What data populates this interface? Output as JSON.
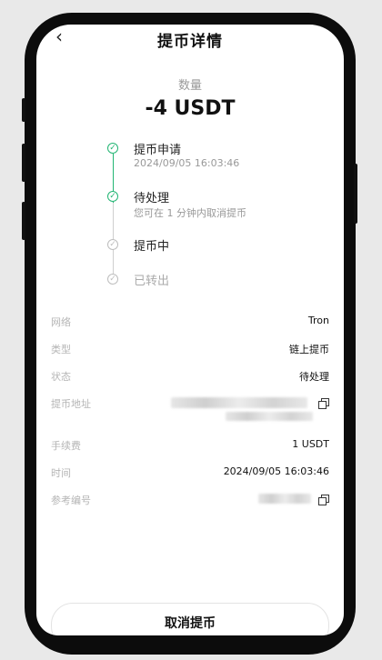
{
  "header": {
    "back_icon": "chevron-left-icon",
    "title": "提币详情"
  },
  "summary": {
    "label": "数量",
    "amount": "-4 USDT"
  },
  "timeline": [
    {
      "title": "提币申请",
      "subtitle": "2024/09/05 16:03:46",
      "status": "done"
    },
    {
      "title": "待处理",
      "subtitle": "您可在 1 分钟内取消提币",
      "status": "done"
    },
    {
      "title": "提币中",
      "subtitle": "",
      "status": "pending"
    },
    {
      "title": "已转出",
      "subtitle": "",
      "status": "pending"
    }
  ],
  "details": {
    "network": {
      "label": "网络",
      "value": "Tron"
    },
    "type": {
      "label": "类型",
      "value": "链上提币"
    },
    "status": {
      "label": "状态",
      "value": "待处理"
    },
    "address": {
      "label": "提币地址"
    },
    "fee": {
      "label": "手续费",
      "value": "1 USDT"
    },
    "time": {
      "label": "时间",
      "value": "2024/09/05 16:03:46"
    },
    "reference": {
      "label": "参考编号"
    }
  },
  "actions": {
    "cancel": "取消提币"
  },
  "colors": {
    "success": "#22b573",
    "pending": "#bdbdbd",
    "muted": "#999999"
  }
}
